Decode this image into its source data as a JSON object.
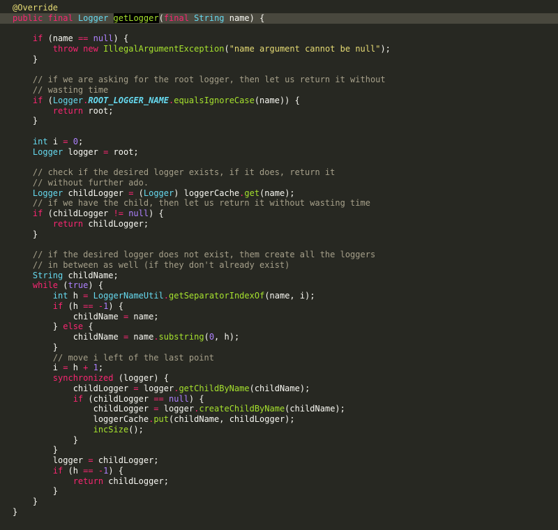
{
  "editor": {
    "theme_colors": {
      "background": "#272822",
      "current_line": "#49483E",
      "keyword": "#F92672",
      "type": "#66D9EF",
      "number": "#AE81FF",
      "string": "#E6DB74",
      "comment": "#A6A08A",
      "function": "#A6E22E",
      "plain": "#F8F8F2"
    },
    "lines": [
      [
        [
          "ann",
          "@Override"
        ]
      ],
      [
        [
          "kw",
          "public"
        ],
        [
          "plain",
          " "
        ],
        [
          "kw",
          "final"
        ],
        [
          "plain",
          " "
        ],
        [
          "type",
          "Logger"
        ],
        [
          "plain",
          " "
        ],
        [
          "match",
          "getLogger"
        ],
        [
          "plain",
          "("
        ],
        [
          "kw",
          "final"
        ],
        [
          "plain",
          " "
        ],
        [
          "type",
          "String"
        ],
        [
          "plain",
          " name) {"
        ]
      ],
      [],
      [
        [
          "plain",
          "    "
        ],
        [
          "kw",
          "if"
        ],
        [
          "plain",
          " (name "
        ],
        [
          "op",
          "=="
        ],
        [
          "plain",
          " "
        ],
        [
          "num",
          "null"
        ],
        [
          "plain",
          ") {"
        ]
      ],
      [
        [
          "plain",
          "        "
        ],
        [
          "kw",
          "throw"
        ],
        [
          "plain",
          " "
        ],
        [
          "kw",
          "new"
        ],
        [
          "plain",
          " "
        ],
        [
          "fn",
          "IllegalArgumentException"
        ],
        [
          "plain",
          "("
        ],
        [
          "str",
          "\"name argument cannot be null\""
        ],
        [
          "plain",
          ");"
        ]
      ],
      [
        [
          "plain",
          "    }"
        ]
      ],
      [],
      [
        [
          "plain",
          "    "
        ],
        [
          "cm",
          "// if we are asking for the root logger, then let us return it without"
        ]
      ],
      [
        [
          "plain",
          "    "
        ],
        [
          "cm",
          "// wasting time"
        ]
      ],
      [
        [
          "plain",
          "    "
        ],
        [
          "kw",
          "if"
        ],
        [
          "plain",
          " ("
        ],
        [
          "type",
          "Logger"
        ],
        [
          "op",
          "."
        ],
        [
          "const",
          "ROOT_LOGGER_NAME"
        ],
        [
          "op",
          "."
        ],
        [
          "fn",
          "equalsIgnoreCase"
        ],
        [
          "plain",
          "(name)) {"
        ]
      ],
      [
        [
          "plain",
          "        "
        ],
        [
          "kw",
          "return"
        ],
        [
          "plain",
          " root;"
        ]
      ],
      [
        [
          "plain",
          "    }"
        ]
      ],
      [],
      [
        [
          "plain",
          "    "
        ],
        [
          "type",
          "int"
        ],
        [
          "plain",
          " i "
        ],
        [
          "op",
          "="
        ],
        [
          "plain",
          " "
        ],
        [
          "num",
          "0"
        ],
        [
          "plain",
          ";"
        ]
      ],
      [
        [
          "plain",
          "    "
        ],
        [
          "type",
          "Logger"
        ],
        [
          "plain",
          " logger "
        ],
        [
          "op",
          "="
        ],
        [
          "plain",
          " root;"
        ]
      ],
      [],
      [
        [
          "plain",
          "    "
        ],
        [
          "cm",
          "// check if the desired logger exists, if it does, return it"
        ]
      ],
      [
        [
          "plain",
          "    "
        ],
        [
          "cm",
          "// without further ado."
        ]
      ],
      [
        [
          "plain",
          "    "
        ],
        [
          "type",
          "Logger"
        ],
        [
          "plain",
          " childLogger "
        ],
        [
          "op",
          "="
        ],
        [
          "plain",
          " ("
        ],
        [
          "type",
          "Logger"
        ],
        [
          "plain",
          ") loggerCache"
        ],
        [
          "op",
          "."
        ],
        [
          "fn",
          "get"
        ],
        [
          "plain",
          "(name);"
        ]
      ],
      [
        [
          "plain",
          "    "
        ],
        [
          "cm",
          "// if we have the child, then let us return it without wasting time"
        ]
      ],
      [
        [
          "plain",
          "    "
        ],
        [
          "kw",
          "if"
        ],
        [
          "plain",
          " (childLogger "
        ],
        [
          "op",
          "!="
        ],
        [
          "plain",
          " "
        ],
        [
          "num",
          "null"
        ],
        [
          "plain",
          ") {"
        ]
      ],
      [
        [
          "plain",
          "        "
        ],
        [
          "kw",
          "return"
        ],
        [
          "plain",
          " childLogger;"
        ]
      ],
      [
        [
          "plain",
          "    }"
        ]
      ],
      [],
      [
        [
          "plain",
          "    "
        ],
        [
          "cm",
          "// if the desired logger does not exist, them create all the loggers"
        ]
      ],
      [
        [
          "plain",
          "    "
        ],
        [
          "cm",
          "// in between as well (if they don't already exist)"
        ]
      ],
      [
        [
          "plain",
          "    "
        ],
        [
          "type",
          "String"
        ],
        [
          "plain",
          " childName;"
        ]
      ],
      [
        [
          "plain",
          "    "
        ],
        [
          "kw",
          "while"
        ],
        [
          "plain",
          " ("
        ],
        [
          "num",
          "true"
        ],
        [
          "plain",
          ") {"
        ]
      ],
      [
        [
          "plain",
          "        "
        ],
        [
          "type",
          "int"
        ],
        [
          "plain",
          " h "
        ],
        [
          "op",
          "="
        ],
        [
          "plain",
          " "
        ],
        [
          "type",
          "LoggerNameUtil"
        ],
        [
          "op",
          "."
        ],
        [
          "fn",
          "getSeparatorIndexOf"
        ],
        [
          "plain",
          "(name, i);"
        ]
      ],
      [
        [
          "plain",
          "        "
        ],
        [
          "kw",
          "if"
        ],
        [
          "plain",
          " (h "
        ],
        [
          "op",
          "=="
        ],
        [
          "plain",
          " "
        ],
        [
          "op",
          "-"
        ],
        [
          "num",
          "1"
        ],
        [
          "plain",
          ") {"
        ]
      ],
      [
        [
          "plain",
          "            childName "
        ],
        [
          "op",
          "="
        ],
        [
          "plain",
          " name;"
        ]
      ],
      [
        [
          "plain",
          "        } "
        ],
        [
          "kw",
          "else"
        ],
        [
          "plain",
          " {"
        ]
      ],
      [
        [
          "plain",
          "            childName "
        ],
        [
          "op",
          "="
        ],
        [
          "plain",
          " name"
        ],
        [
          "op",
          "."
        ],
        [
          "fn",
          "substring"
        ],
        [
          "plain",
          "("
        ],
        [
          "num",
          "0"
        ],
        [
          "plain",
          ", h);"
        ]
      ],
      [
        [
          "plain",
          "        }"
        ]
      ],
      [
        [
          "plain",
          "        "
        ],
        [
          "cm",
          "// move i left of the last point"
        ]
      ],
      [
        [
          "plain",
          "        i "
        ],
        [
          "op",
          "="
        ],
        [
          "plain",
          " h "
        ],
        [
          "op",
          "+"
        ],
        [
          "plain",
          " "
        ],
        [
          "num",
          "1"
        ],
        [
          "plain",
          ";"
        ]
      ],
      [
        [
          "plain",
          "        "
        ],
        [
          "kw",
          "synchronized"
        ],
        [
          "plain",
          " (logger) {"
        ]
      ],
      [
        [
          "plain",
          "            childLogger "
        ],
        [
          "op",
          "="
        ],
        [
          "plain",
          " logger"
        ],
        [
          "op",
          "."
        ],
        [
          "fn",
          "getChildByName"
        ],
        [
          "plain",
          "(childName);"
        ]
      ],
      [
        [
          "plain",
          "            "
        ],
        [
          "kw",
          "if"
        ],
        [
          "plain",
          " (childLogger "
        ],
        [
          "op",
          "=="
        ],
        [
          "plain",
          " "
        ],
        [
          "num",
          "null"
        ],
        [
          "plain",
          ") {"
        ]
      ],
      [
        [
          "plain",
          "                childLogger "
        ],
        [
          "op",
          "="
        ],
        [
          "plain",
          " logger"
        ],
        [
          "op",
          "."
        ],
        [
          "fn",
          "createChildByName"
        ],
        [
          "plain",
          "(childName);"
        ]
      ],
      [
        [
          "plain",
          "                loggerCache"
        ],
        [
          "op",
          "."
        ],
        [
          "fn",
          "put"
        ],
        [
          "plain",
          "(childName, childLogger);"
        ]
      ],
      [
        [
          "plain",
          "                "
        ],
        [
          "fn",
          "incSize"
        ],
        [
          "plain",
          "();"
        ]
      ],
      [
        [
          "plain",
          "            }"
        ]
      ],
      [
        [
          "plain",
          "        }"
        ]
      ],
      [
        [
          "plain",
          "        logger "
        ],
        [
          "op",
          "="
        ],
        [
          "plain",
          " childLogger;"
        ]
      ],
      [
        [
          "plain",
          "        "
        ],
        [
          "kw",
          "if"
        ],
        [
          "plain",
          " (h "
        ],
        [
          "op",
          "=="
        ],
        [
          "plain",
          " "
        ],
        [
          "op",
          "-"
        ],
        [
          "num",
          "1"
        ],
        [
          "plain",
          ") {"
        ]
      ],
      [
        [
          "plain",
          "            "
        ],
        [
          "kw",
          "return"
        ],
        [
          "plain",
          " childLogger;"
        ]
      ],
      [
        [
          "plain",
          "        }"
        ]
      ],
      [
        [
          "plain",
          "    }"
        ]
      ],
      [
        [
          "plain",
          "}"
        ]
      ]
    ]
  }
}
